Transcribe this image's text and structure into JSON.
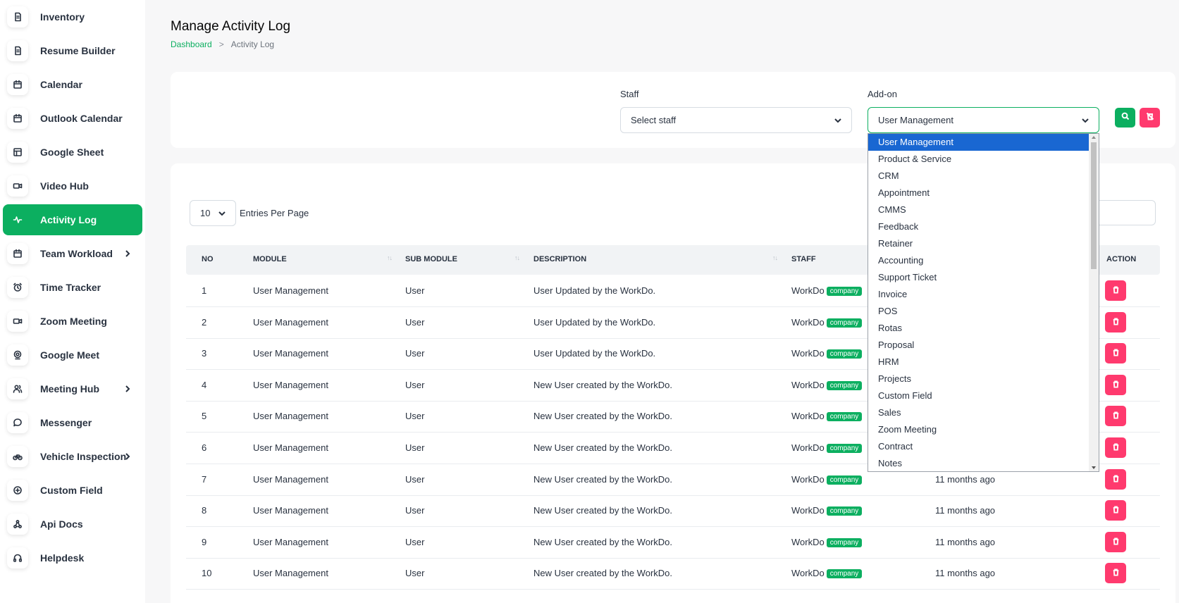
{
  "colors": {
    "primary": "#0caf60",
    "danger": "#ff3a6e",
    "selected": "#1967d2"
  },
  "sidebar": {
    "items": [
      {
        "label": "Inventory",
        "icon": "file-icon"
      },
      {
        "label": "Resume Builder",
        "icon": "file-icon"
      },
      {
        "label": "Calendar",
        "icon": "calendar-icon"
      },
      {
        "label": "Outlook Calendar",
        "icon": "calendar-icon"
      },
      {
        "label": "Google Sheet",
        "icon": "table-icon"
      },
      {
        "label": "Video Hub",
        "icon": "video-icon"
      },
      {
        "label": "Activity Log",
        "icon": "activity-icon",
        "active": true
      },
      {
        "label": "Team Workload",
        "icon": "calendar-icon",
        "submenu": true
      },
      {
        "label": "Time Tracker",
        "icon": "alarm-clock-icon"
      },
      {
        "label": "Zoom Meeting",
        "icon": "video-icon"
      },
      {
        "label": "Google Meet",
        "icon": "map-pin-icon"
      },
      {
        "label": "Meeting Hub",
        "icon": "users-icon",
        "submenu": true
      },
      {
        "label": "Messenger",
        "icon": "message-icon"
      },
      {
        "label": "Vehicle Inspection",
        "icon": "bike-icon",
        "submenu": true
      },
      {
        "label": "Custom Field",
        "icon": "plus-circle-icon"
      },
      {
        "label": "Api Docs",
        "icon": "webhook-icon"
      },
      {
        "label": "Helpdesk",
        "icon": "headphones-icon"
      }
    ]
  },
  "header": {
    "title": "Manage Activity Log",
    "breadcrumb": {
      "home": "Dashboard",
      "separator": ">",
      "current": "Activity Log"
    }
  },
  "filters": {
    "staff_label": "Staff",
    "staff_value": "Select staff",
    "addon_label": "Add-on",
    "addon_value": "User Management"
  },
  "table": {
    "entries_value": "10",
    "entries_label": "Entries Per Page",
    "columns": [
      "NO",
      "MODULE",
      "SUB MODULE",
      "DESCRIPTION",
      "STAFF",
      "ACTION"
    ],
    "rows": [
      {
        "no": "1",
        "module": "User Management",
        "sub": "User",
        "desc": "User Updated by the WorkDo.",
        "staff": "WorkDo",
        "badge": "company",
        "time": ""
      },
      {
        "no": "2",
        "module": "User Management",
        "sub": "User",
        "desc": "User Updated by the WorkDo.",
        "staff": "WorkDo",
        "badge": "company",
        "time": ""
      },
      {
        "no": "3",
        "module": "User Management",
        "sub": "User",
        "desc": "User Updated by the WorkDo.",
        "staff": "WorkDo",
        "badge": "company",
        "time": ""
      },
      {
        "no": "4",
        "module": "User Management",
        "sub": "User",
        "desc": "New User created by the WorkDo.",
        "staff": "WorkDo",
        "badge": "company",
        "time": ""
      },
      {
        "no": "5",
        "module": "User Management",
        "sub": "User",
        "desc": "New User created by the WorkDo.",
        "staff": "WorkDo",
        "badge": "company",
        "time": ""
      },
      {
        "no": "6",
        "module": "User Management",
        "sub": "User",
        "desc": "New User created by the WorkDo.",
        "staff": "WorkDo",
        "badge": "company",
        "time": ""
      },
      {
        "no": "7",
        "module": "User Management",
        "sub": "User",
        "desc": "New User created by the WorkDo.",
        "staff": "WorkDo",
        "badge": "company",
        "time": "11 months ago"
      },
      {
        "no": "8",
        "module": "User Management",
        "sub": "User",
        "desc": "New User created by the WorkDo.",
        "staff": "WorkDo",
        "badge": "company",
        "time": "11 months ago"
      },
      {
        "no": "9",
        "module": "User Management",
        "sub": "User",
        "desc": "New User created by the WorkDo.",
        "staff": "WorkDo",
        "badge": "company",
        "time": "11 months ago"
      },
      {
        "no": "10",
        "module": "User Management",
        "sub": "User",
        "desc": "New User created by the WorkDo.",
        "staff": "WorkDo",
        "badge": "company",
        "time": "11 months ago"
      }
    ]
  },
  "addon_dropdown": {
    "options": [
      "User Management",
      "Product & Service",
      "CRM",
      "Appointment",
      "CMMS",
      "Feedback",
      "Retainer",
      "Accounting",
      "Support Ticket",
      "Invoice",
      "POS",
      "Rotas",
      "Proposal",
      "HRM",
      "Projects",
      "Custom Field",
      "Sales",
      "Zoom Meeting",
      "Contract",
      "Notes"
    ],
    "selected_index": 0
  }
}
